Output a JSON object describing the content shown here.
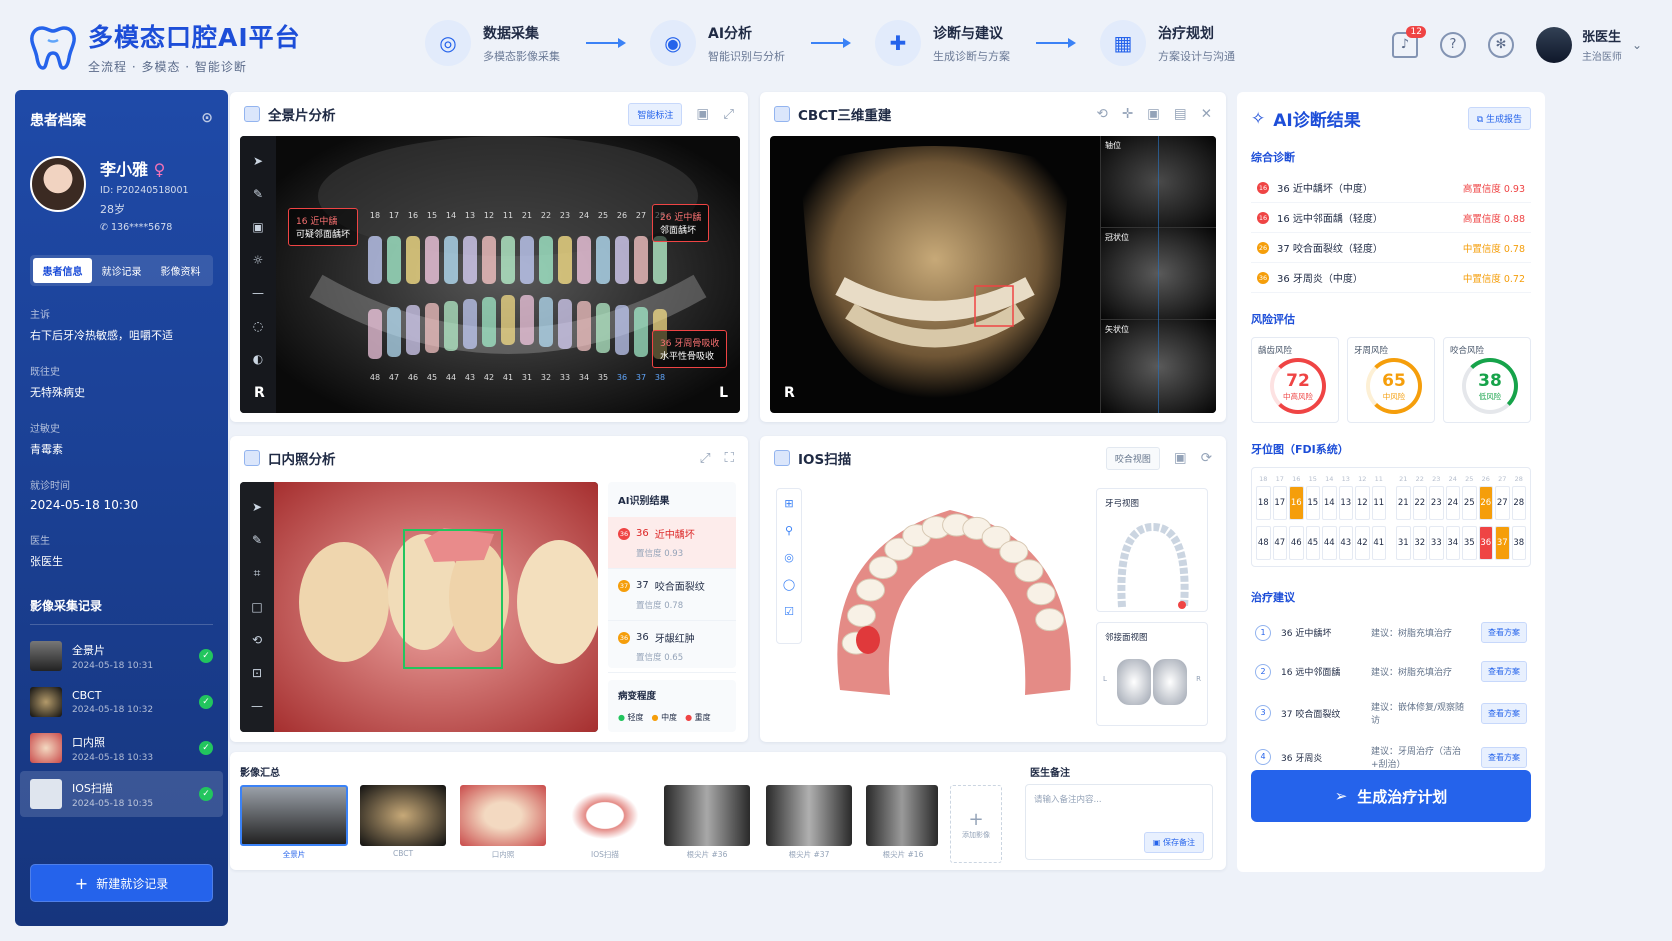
{
  "app": {
    "title": "多模态口腔AI平台",
    "subtitle": "全流程 · 多模态 · 智能诊断"
  },
  "steps": [
    {
      "title": "数据采集",
      "sub": "多模态影像采集",
      "icon": "scan-icon"
    },
    {
      "title": "AI分析",
      "sub": "智能识别与分析",
      "icon": "ai-eye-icon"
    },
    {
      "title": "诊断与建议",
      "sub": "生成诊断与方案",
      "icon": "hospital-icon"
    },
    {
      "title": "治疗规划",
      "sub": "方案设计与沟通",
      "icon": "calendar-icon"
    }
  ],
  "header": {
    "notifications": "12",
    "user_name": "张医生",
    "user_role": "主治医师"
  },
  "sidebar": {
    "title": "患者档案",
    "patient": {
      "name": "李小雅",
      "id": "ID: P20240518001",
      "age": "28岁",
      "phone": "136****5678"
    },
    "tabs": [
      "患者信息",
      "就诊记录",
      "影像资料"
    ],
    "fields": [
      {
        "label": "主诉",
        "value": "右下后牙冷热敏感，咀嚼不适"
      },
      {
        "label": "既往史",
        "value": "无特殊病史"
      },
      {
        "label": "过敏史",
        "value": "青霉素"
      },
      {
        "label": "就诊时间",
        "value": "2024-05-18 10:30"
      },
      {
        "label": "医生",
        "value": "张医生"
      }
    ],
    "records_title": "影像采集记录",
    "records": [
      {
        "name": "全景片",
        "time": "2024-05-18 10:31"
      },
      {
        "name": "CBCT",
        "time": "2024-05-18 10:32"
      },
      {
        "name": "口内照",
        "time": "2024-05-18 10:33"
      },
      {
        "name": "IOS扫描",
        "time": "2024-05-18 10:35"
      }
    ],
    "new_button": "新建就诊记录"
  },
  "panorama": {
    "title": "全景片分析",
    "chip": "智能标注",
    "tag_left": {
      "id": "16",
      "title": "近中龋",
      "desc": "可疑邻面龋坏"
    },
    "tag_right": {
      "id": "26",
      "title": "近中龋",
      "desc": "邻面龋坏"
    },
    "tag_bottom": {
      "id": "36",
      "title": "牙周骨吸收",
      "desc": "水平性骨吸收"
    },
    "upper_numbers": [
      "18",
      "17",
      "16",
      "15",
      "14",
      "13",
      "12",
      "11",
      "21",
      "22",
      "23",
      "24",
      "25",
      "26",
      "27",
      "28"
    ],
    "lower_numbers": [
      "48",
      "47",
      "46",
      "45",
      "44",
      "43",
      "42",
      "41",
      "31",
      "32",
      "33",
      "34",
      "35",
      "36",
      "37",
      "38"
    ],
    "left_mark": "R",
    "right_mark": "L"
  },
  "cbct": {
    "title": "CBCT三维重建",
    "views": [
      "轴位",
      "冠状位",
      "矢状位"
    ],
    "mark": "R"
  },
  "intraoral": {
    "title": "口内照分析",
    "ai_title": "AI识别结果",
    "ai_items": [
      {
        "id": "36",
        "name": "近中龋坏",
        "conf": "置信度 0.93",
        "color": "#ef4444"
      },
      {
        "id": "37",
        "name": "咬合面裂纹",
        "conf": "置信度 0.78",
        "color": "#f59e0b"
      },
      {
        "id": "36",
        "name": "牙龈红肿",
        "conf": "置信度 0.65",
        "color": "#f59e0b"
      }
    ],
    "severity_title": "病变程度",
    "severity": [
      "轻度",
      "中度",
      "重度"
    ]
  },
  "ios": {
    "title": "IOS扫描",
    "chip": "咬合视图",
    "view1": "牙弓视图",
    "view2": "邻接面视图",
    "l": "L",
    "r": "R"
  },
  "gallery": {
    "title": "影像汇总",
    "items": [
      "全景片",
      "CBCT",
      "口内照",
      "IOS扫描",
      "根尖片 #36",
      "根尖片 #37",
      "根尖片 #16"
    ],
    "add": "添加影像"
  },
  "notes": {
    "title": "医生备注",
    "placeholder": "请输入备注内容...",
    "save": "保存备注"
  },
  "ai": {
    "title": "AI诊断结果",
    "report": "生成报告",
    "diag_title": "综合诊断",
    "diagnoses": [
      {
        "id": "16",
        "text": "36 近中龋坏（中度）",
        "conf": "高置信度 0.93",
        "color": "#ef4444"
      },
      {
        "id": "16",
        "text": "16 远中邻面龋（轻度）",
        "conf": "高置信度 0.88",
        "color": "#ef4444"
      },
      {
        "id": "26",
        "text": "37 咬合面裂纹（轻度）",
        "conf": "中置信度 0.78",
        "color": "#f59e0b"
      },
      {
        "id": "36",
        "text": "36 牙周炎（中度）",
        "conf": "中置信度 0.72",
        "color": "#f59e0b"
      }
    ],
    "risk_title": "风险评估",
    "risks": [
      {
        "label": "龋齿风险",
        "value": "72",
        "level": "中高风险",
        "color": "#ef4444"
      },
      {
        "label": "牙周风险",
        "value": "65",
        "level": "中风险",
        "color": "#f59e0b"
      },
      {
        "label": "咬合风险",
        "value": "38",
        "level": "低风险",
        "color": "#16a34a"
      }
    ],
    "teeth_title": "牙位图（FDI系统）",
    "teeth_upper": [
      "18",
      "17",
      "16",
      "15",
      "14",
      "13",
      "12",
      "11",
      "21",
      "22",
      "23",
      "24",
      "25",
      "26",
      "27",
      "28"
    ],
    "teeth_lower": [
      "48",
      "47",
      "46",
      "45",
      "44",
      "43",
      "42",
      "41",
      "31",
      "32",
      "33",
      "34",
      "35",
      "36",
      "37",
      "38"
    ],
    "tx_title": "治疗建议",
    "treatments": [
      {
        "n": "1",
        "name": "36 近中龋坏",
        "sugg": "建议：树脂充填治疗",
        "btn": "查看方案"
      },
      {
        "n": "2",
        "name": "16 远中邻面龋",
        "sugg": "建议：树脂充填治疗",
        "btn": "查看方案"
      },
      {
        "n": "3",
        "name": "37 咬合面裂纹",
        "sugg": "建议：嵌体修复/观察随访",
        "btn": "查看方案"
      },
      {
        "n": "4",
        "name": "36 牙周炎",
        "sugg": "建议：牙周治疗（洁治+刮治）",
        "btn": "查看方案"
      }
    ],
    "generate": "生成治疗计划"
  }
}
